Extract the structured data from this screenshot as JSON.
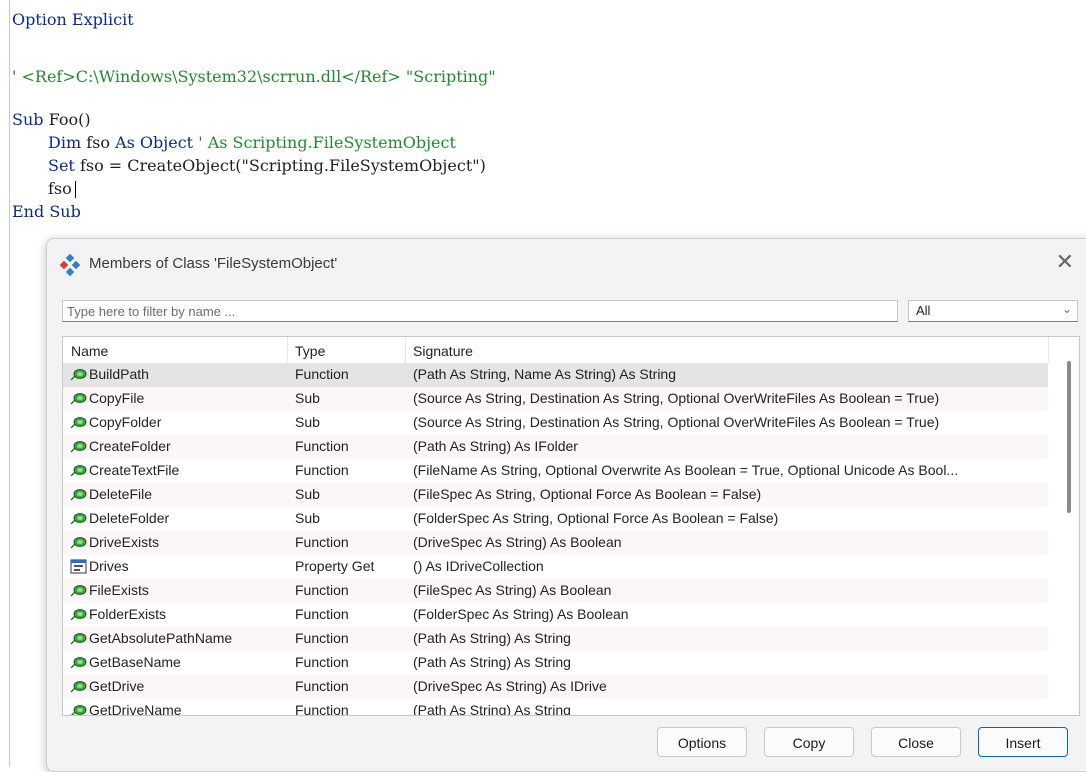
{
  "editor": {
    "lines": [
      "Option Explicit",
      "' <Ref>C:\\Windows\\System32\\scrrun.dll</Ref> \"Scripting\"",
      "Sub Foo()",
      "Dim fso As Object ' As Scripting.FileSystemObject",
      "Set fso = CreateObject(\"Scripting.FileSystemObject\")",
      "fso",
      "End Sub"
    ]
  },
  "dialog": {
    "title": "Members of Class 'FileSystemObject'",
    "close_glyph": "✕",
    "filter_placeholder": "Type here to filter by name ...",
    "scope_value": "All",
    "columns": {
      "name": "Name",
      "type": "Type",
      "signature": "Signature"
    },
    "rows": [
      {
        "icon": "method-icon",
        "name": "BuildPath",
        "type": "Function",
        "signature": "(Path As String, Name As String) As String"
      },
      {
        "icon": "method-icon",
        "name": "CopyFile",
        "type": "Sub",
        "signature": "(Source As String, Destination As String, Optional OverWriteFiles As Boolean = True)"
      },
      {
        "icon": "method-icon",
        "name": "CopyFolder",
        "type": "Sub",
        "signature": "(Source As String, Destination As String, Optional OverWriteFiles As Boolean = True)"
      },
      {
        "icon": "method-icon",
        "name": "CreateFolder",
        "type": "Function",
        "signature": "(Path As String) As IFolder"
      },
      {
        "icon": "method-icon",
        "name": "CreateTextFile",
        "type": "Function",
        "signature": "(FileName As String, Optional Overwrite As Boolean = True, Optional Unicode As Bool..."
      },
      {
        "icon": "method-icon",
        "name": "DeleteFile",
        "type": "Sub",
        "signature": "(FileSpec As String, Optional Force As Boolean = False)"
      },
      {
        "icon": "method-icon",
        "name": "DeleteFolder",
        "type": "Sub",
        "signature": "(FolderSpec As String, Optional Force As Boolean = False)"
      },
      {
        "icon": "method-icon",
        "name": "DriveExists",
        "type": "Function",
        "signature": "(DriveSpec As String) As Boolean"
      },
      {
        "icon": "property-icon",
        "name": "Drives",
        "type": "Property Get",
        "signature": "() As IDriveCollection"
      },
      {
        "icon": "method-icon",
        "name": "FileExists",
        "type": "Function",
        "signature": "(FileSpec As String) As Boolean"
      },
      {
        "icon": "method-icon",
        "name": "FolderExists",
        "type": "Function",
        "signature": "(FolderSpec As String) As Boolean"
      },
      {
        "icon": "method-icon",
        "name": "GetAbsolutePathName",
        "type": "Function",
        "signature": "(Path As String) As String"
      },
      {
        "icon": "method-icon",
        "name": "GetBaseName",
        "type": "Function",
        "signature": "(Path As String) As String"
      },
      {
        "icon": "method-icon",
        "name": "GetDrive",
        "type": "Function",
        "signature": "(DriveSpec As String) As IDrive"
      },
      {
        "icon": "method-icon",
        "name": "GetDriveName",
        "type": "Function",
        "signature": "(Path As String) As String"
      }
    ],
    "buttons": {
      "options": "Options",
      "copy": "Copy",
      "close": "Close",
      "insert": "Insert"
    }
  }
}
